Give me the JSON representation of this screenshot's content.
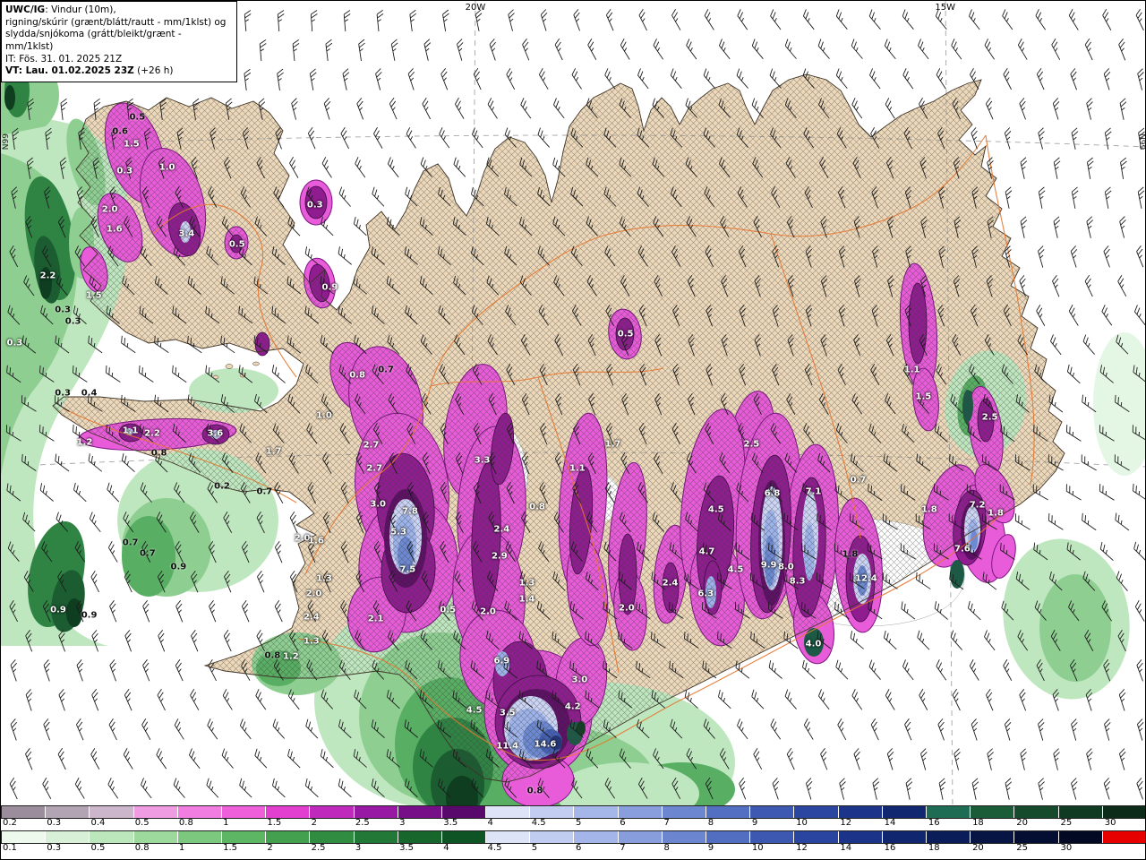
{
  "header": {
    "model": "UWC/IG",
    "subtitle1": ": Vindur (10m),",
    "line2": "rigning/skúrir (grænt/blátt/rautt - mm/1klst) og",
    "line3": "slydda/snjókoma (grátt/bleikt/grænt - mm/1klst)",
    "it": "IT: Fös. 31. 01. 2025 21Z",
    "vt": "VT: Lau. 01.02.2025 23Z",
    "vt_suffix": " (+26 h)"
  },
  "map": {
    "lon_labels": [
      {
        "text": "20W",
        "x_pct": 41.4
      },
      {
        "text": "15W",
        "x_pct": 82.4
      }
    ],
    "edge_labels": {
      "left": "N99",
      "right": "N99"
    },
    "values": [
      [
        "0.5",
        11.9,
        14.4,
        "k"
      ],
      [
        "0.6",
        10.4,
        16.2,
        "k"
      ],
      [
        "1.5",
        11.4,
        17.8,
        "w"
      ],
      [
        "0.3",
        10.8,
        21.1,
        "w"
      ],
      [
        "1.0",
        14.5,
        20.7,
        "w"
      ],
      [
        "2.0",
        9.5,
        25.9,
        "w"
      ],
      [
        "1.6",
        9.9,
        28.3,
        "w"
      ],
      [
        "3.4",
        16.2,
        28.9,
        "w"
      ],
      [
        "0.3",
        27.4,
        25.3,
        "w"
      ],
      [
        "0.5",
        20.6,
        30.2,
        "w"
      ],
      [
        "2.2",
        4.1,
        34.1,
        "w"
      ],
      [
        "1.5",
        8.1,
        36.6,
        "w"
      ],
      [
        "0.3",
        5.4,
        38.3,
        "k"
      ],
      [
        "0.3",
        6.3,
        39.8,
        "k"
      ],
      [
        "0.3",
        1.2,
        42.4,
        "w"
      ],
      [
        "0.9",
        28.7,
        35.6,
        "w"
      ],
      [
        "0.3",
        5.4,
        48.7,
        "k"
      ],
      [
        "0.4",
        7.7,
        48.7,
        "k"
      ],
      [
        "0.8",
        31.1,
        46.4,
        "w"
      ],
      [
        "0.7",
        33.6,
        45.8,
        "k"
      ],
      [
        "1.1",
        11.3,
        53.3,
        "w"
      ],
      [
        "2.2",
        13.2,
        53.7,
        "w"
      ],
      [
        "1.2",
        7.3,
        54.8,
        "w"
      ],
      [
        "3.6",
        18.7,
        53.7,
        "w"
      ],
      [
        "0.8",
        13.8,
        56.1,
        "k"
      ],
      [
        "1.7",
        23.8,
        55.9,
        "w"
      ],
      [
        "1.0",
        28.2,
        51.4,
        "w"
      ],
      [
        "2.7",
        32.3,
        55.1,
        "w"
      ],
      [
        "2.7",
        32.6,
        58.0,
        "w"
      ],
      [
        "3.3",
        42.0,
        57.0,
        "w"
      ],
      [
        "3.0",
        32.9,
        62.4,
        "w"
      ],
      [
        "7.8",
        35.7,
        63.3,
        "w"
      ],
      [
        "5.3",
        34.7,
        65.9,
        "w"
      ],
      [
        "0.2",
        19.3,
        60.2,
        "k"
      ],
      [
        "0.7",
        23.0,
        60.9,
        "k"
      ],
      [
        "2.0",
        26.3,
        66.7,
        "w"
      ],
      [
        "1.6",
        27.5,
        67.0,
        "w"
      ],
      [
        "7.5",
        35.5,
        70.6,
        "w"
      ],
      [
        "0.7",
        11.3,
        67.2,
        "k"
      ],
      [
        "0.7",
        12.8,
        68.6,
        "k"
      ],
      [
        "0.9",
        15.5,
        70.2,
        "k"
      ],
      [
        "1.3",
        28.2,
        71.7,
        "w"
      ],
      [
        "2.0",
        27.3,
        73.6,
        "w"
      ],
      [
        "2.4",
        27.1,
        76.4,
        "w"
      ],
      [
        "0.9",
        5.0,
        75.6,
        "w"
      ],
      [
        "0.9",
        7.7,
        76.2,
        "k"
      ],
      [
        "2.1",
        32.7,
        76.7,
        "w"
      ],
      [
        "1.3",
        27.1,
        79.4,
        "w"
      ],
      [
        "1.2",
        25.3,
        81.3,
        "w"
      ],
      [
        "0.8",
        23.7,
        81.2,
        "k"
      ],
      [
        "0.5",
        39.0,
        75.6,
        "w"
      ],
      [
        "2.0",
        42.5,
        75.8,
        "w"
      ],
      [
        "1.3",
        45.9,
        72.2,
        "w"
      ],
      [
        "1.4",
        45.9,
        74.2,
        "w"
      ],
      [
        "2.4",
        43.7,
        65.6,
        "w"
      ],
      [
        "2.9",
        43.5,
        68.9,
        "w"
      ],
      [
        "0.8",
        46.8,
        62.8,
        "w"
      ],
      [
        "1.1",
        50.3,
        58.0,
        "w"
      ],
      [
        "1.7",
        53.4,
        55.0,
        "w"
      ],
      [
        "6.9",
        43.7,
        81.9,
        "w"
      ],
      [
        "4.5",
        41.3,
        88.0,
        "w"
      ],
      [
        "3.5",
        44.2,
        88.3,
        "w"
      ],
      [
        "4.2",
        49.9,
        87.6,
        "w"
      ],
      [
        "3.0",
        50.5,
        84.2,
        "w"
      ],
      [
        "11.4",
        44.2,
        92.4,
        "w"
      ],
      [
        "14.6",
        47.5,
        92.2,
        "w"
      ],
      [
        "0.8",
        46.6,
        98.0,
        "k"
      ],
      [
        "2.4",
        58.4,
        72.2,
        "w"
      ],
      [
        "2.0",
        54.6,
        75.3,
        "w"
      ],
      [
        "6.3",
        61.5,
        73.6,
        "w"
      ],
      [
        "4.5",
        62.4,
        63.1,
        "w"
      ],
      [
        "4.7",
        61.6,
        68.3,
        "w"
      ],
      [
        "4.5",
        64.1,
        70.6,
        "w"
      ],
      [
        "6.8",
        67.3,
        61.1,
        "w"
      ],
      [
        "9.9",
        67.0,
        70.0,
        "w"
      ],
      [
        "8.0",
        68.5,
        70.2,
        "w"
      ],
      [
        "7.1",
        70.9,
        60.9,
        "w"
      ],
      [
        "8.3",
        69.5,
        72.0,
        "w"
      ],
      [
        "12.4",
        75.5,
        71.7,
        "w"
      ],
      [
        "1.8",
        74.1,
        68.7,
        "k"
      ],
      [
        "4.0",
        70.9,
        79.8,
        "w"
      ],
      [
        "2.5",
        65.5,
        55.0,
        "w"
      ],
      [
        "0.5",
        54.5,
        41.3,
        "w"
      ],
      [
        "1.1",
        79.5,
        45.8,
        "w"
      ],
      [
        "1.5",
        80.5,
        49.1,
        "w"
      ],
      [
        "2.5",
        86.3,
        51.7,
        "w"
      ],
      [
        "0.7",
        74.8,
        59.4,
        "w"
      ],
      [
        "1.8",
        81.0,
        63.1,
        "w"
      ],
      [
        "7.2",
        85.2,
        62.6,
        "w"
      ],
      [
        "7.6",
        83.9,
        68.0,
        "w"
      ],
      [
        "1.8",
        86.8,
        63.6,
        "w"
      ]
    ]
  },
  "colorbars": {
    "top": {
      "name": "slydda/snjókoma (mm/1klst)",
      "labels": [
        "0.2",
        "0.3",
        "0.4",
        "0.5",
        "0.8",
        "1",
        "1.5",
        "2",
        "2.5",
        "3",
        "3.5",
        "4",
        "4.5",
        "5",
        "6",
        "7",
        "8",
        "9",
        "10",
        "12",
        "14",
        "16",
        "18",
        "20",
        "25",
        "30"
      ],
      "colors": [
        "#9b8d9b",
        "#b3a4b3",
        "#ccb6cc",
        "#ef9ce3",
        "#f17de0",
        "#ee5fd9",
        "#e23fd0",
        "#c02abc",
        "#9819a4",
        "#770f88",
        "#59086b",
        "#dfe3f7",
        "#c2cdf1",
        "#a5b6e9",
        "#889edd",
        "#6c86cf",
        "#536fc1",
        "#3e59b1",
        "#2b46a0",
        "#1c358b",
        "#112871",
        "#1e6c54",
        "#1b5c38",
        "#164a2c",
        "#113a22",
        "#0c2b18"
      ]
    },
    "bottom": {
      "name": "rigning/skúrir (mm/1klst)",
      "labels": [
        "0.1",
        "0.3",
        "0.5",
        "0.8",
        "1",
        "1.5",
        "2",
        "2.5",
        "3",
        "3.5",
        "4",
        "4.5",
        "5",
        "6",
        "7",
        "8",
        "9",
        "10",
        "12",
        "14",
        "16",
        "18",
        "20",
        "25",
        "30"
      ],
      "colors": [
        "#eef9ee",
        "#d7f0d7",
        "#bce6bc",
        "#9dd89d",
        "#7cc87e",
        "#5cb663",
        "#42a04f",
        "#2f8c41",
        "#227836",
        "#17662c",
        "#0f5424",
        "#dde4f8",
        "#c1ccf1",
        "#a4b5e9",
        "#879ddc",
        "#6b85cf",
        "#526ec0",
        "#3d58b0",
        "#2a459f",
        "#1b348a",
        "#102770",
        "#0a1d58",
        "#061543",
        "#040e32",
        "#020922",
        "#e60000"
      ]
    }
  },
  "palette": {
    "land": "#edd9ba",
    "ocean": "#ffffff",
    "road": "#e4762f",
    "magenta": "#e95cd9",
    "dark_purple": "#5c0f63"
  }
}
